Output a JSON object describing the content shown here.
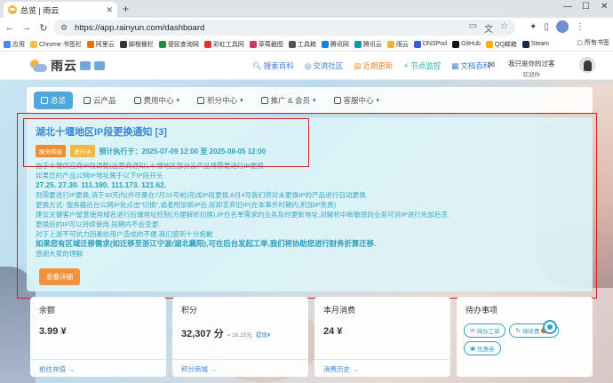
{
  "browser": {
    "tab_title": "总览 | 雨云",
    "url": "https://app.rainyun.com/dashboard",
    "bookmarks": [
      "应用",
      "Chrome 书签栏",
      "阿里云",
      "脚橙栅栏",
      "便民查询网",
      "彩虹工具网",
      "草莓截图",
      "工具箱",
      "腾讯网",
      "腾讯云",
      "雨云",
      "DNSPod",
      "GitHub",
      "QQ邮箱",
      "Steam"
    ],
    "all_bookmarks": "所有书签"
  },
  "header": {
    "logo_text": "雨云",
    "nav": [
      "搜索百科",
      "交流社区",
      "近期更新",
      "节点监控",
      "文档百科"
    ],
    "greeting": "我只是你的过客",
    "greeting_sub": "欢迎你"
  },
  "subnav": [
    {
      "label": "总览",
      "active": true,
      "dropdown": false
    },
    {
      "label": "云产品",
      "active": false,
      "dropdown": false
    },
    {
      "label": "费用中心",
      "active": false,
      "dropdown": true
    },
    {
      "label": "积分中心",
      "active": false,
      "dropdown": true
    },
    {
      "label": "推广 & 会员",
      "active": false,
      "dropdown": true
    },
    {
      "label": "客服中心",
      "active": false,
      "dropdown": true
    }
  ],
  "announcement": {
    "title": "湖北十堰地区IP段更换通知 [3]",
    "badge_type": "服务降级",
    "badge_status": "进行中",
    "period": "预计执行于：2025-07-09 12:00 至 2025-08-05 12:00",
    "lines": [
      {
        "text": "由于十堰供应商IP段调整(运营商通知),十堰地区部分云产品将需要进行IP更换",
        "bold": false
      },
      {
        "text": "如果您的产品公网IP地址属于以下IP段开头",
        "bold": false
      },
      {
        "text": "27.25. 27.30. 111.180. 111.173. 121.62.",
        "bold": true
      },
      {
        "text": "则需要进行IP更换,请于30天内(并尽量在7月31号前)完成IP段更换,8月4号我们将对未更换IP的产品进行自动更换.",
        "bold": false
      },
      {
        "text": "更换方式: 服务器后台公网IP处点击\"切换\",或者附加新IP后,拆卸丢弃旧IP(在本事件时期内,附加IP免费)",
        "bold": false
      },
      {
        "text": "建议关键客户留意使用域名进行后端地址控制(方便解析切换),IP白名单需求的业务及时更新地址,对解析中断敏感的业务可对IP进行先加后丢.",
        "bold": false
      },
      {
        "text": "更换后的IP可以持续使用,短期内不会变更.",
        "bold": false
      },
      {
        "text": "对于上游不可抗力因素给用户造成的不便,我们感到十分抱歉",
        "bold": false
      },
      {
        "text": "如果您有区域迁移需求(如迁移至浙江宁波/湖北襄阳),可在后台发起工单,我们将协助您进行财务折算迁移.",
        "bold": true
      },
      {
        "text": "感谢大家的理解",
        "bold": false
      }
    ],
    "detail_button": "查看详细"
  },
  "cards": [
    {
      "title": "余额",
      "value": "3.99 ¥",
      "footer": "前往充值 →"
    },
    {
      "title": "积分",
      "value": "32,307 分",
      "sub": "≈ 16.15元",
      "link": "提现¥",
      "footer": "积分商城 →"
    },
    {
      "title": "本月消费",
      "value": "24 ¥",
      "footer": "消费历史 →"
    },
    {
      "title": "待办事项",
      "buttons": [
        {
          "label": "待办工单",
          "count": ""
        },
        {
          "label": "待续费",
          "count": "10"
        },
        {
          "label": "优惠券",
          "count": ""
        }
      ]
    }
  ]
}
